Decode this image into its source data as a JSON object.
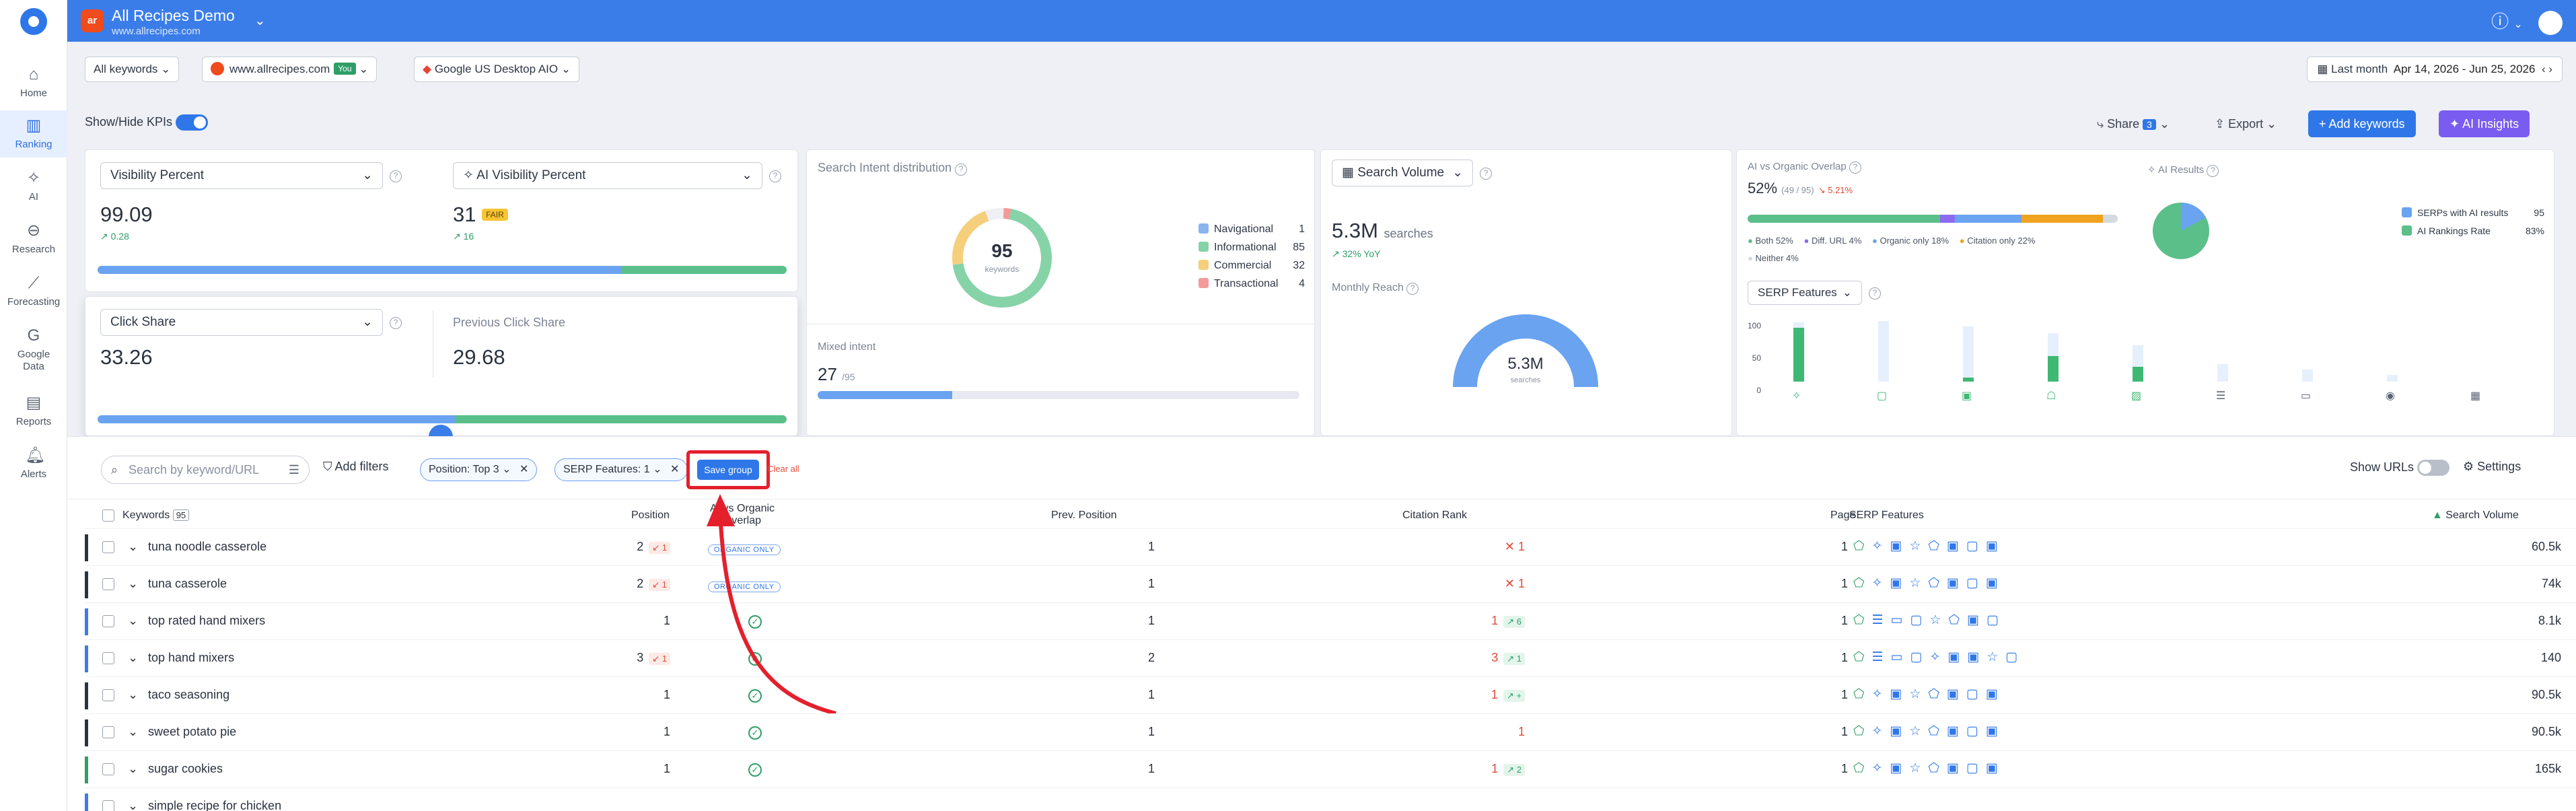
{
  "sidebar": {
    "items": [
      {
        "label": "Home",
        "icon": "home-icon"
      },
      {
        "label": "Ranking",
        "icon": "ranking-icon"
      },
      {
        "label": "AI",
        "icon": "ai-icon"
      },
      {
        "label": "Research",
        "icon": "research-icon"
      },
      {
        "label": "Forecasting",
        "icon": "forecasting-icon"
      },
      {
        "label": "Google Data",
        "icon": "google-data-icon"
      },
      {
        "label": "Reports",
        "icon": "reports-icon"
      },
      {
        "label": "Alerts",
        "icon": "alerts-icon"
      }
    ]
  },
  "project": {
    "name": "All Recipes Demo",
    "url": "www.allrecipes.com",
    "logo": "ar"
  },
  "filters": {
    "keywords": "All keywords",
    "domain": "www.allrecipes.com",
    "you": "You",
    "engine": "Google US Desktop AIO",
    "period_label": "Last month",
    "period": "Apr 14, 2026 - Jun 25, 2026"
  },
  "actions": {
    "kpis": "Show/Hide KPIs",
    "share": "Share",
    "share_count": "3",
    "export": "Export",
    "add": "Add keywords",
    "ai": "AI Insights"
  },
  "kpi": {
    "vis_label": "Visibility Percent",
    "vis_value": "99.09",
    "vis_delta": "0.28",
    "aivis_label": "AI Visibility Percent",
    "aivis_value": "31",
    "aivis_badge": "FAIR",
    "aivis_delta": "16",
    "click_label": "Click Share",
    "click_value": "33.26",
    "prev_label": "Previous Click Share",
    "prev_value": "29.68"
  },
  "intent": {
    "title": "Search Intent distribution",
    "total": "95",
    "total_label": "keywords",
    "items": [
      {
        "label": "Navigational",
        "value": "1",
        "color": "#8ab4f0"
      },
      {
        "label": "Informational",
        "value": "85",
        "color": "#86d3a7"
      },
      {
        "label": "Commercial",
        "value": "32",
        "color": "#f6cf7c"
      },
      {
        "label": "Transactional",
        "value": "4",
        "color": "#f39a9a"
      }
    ],
    "mixed_label": "Mixed intent",
    "mixed_value": "27",
    "mixed_total": "/95",
    "mixed_fraction": 0.28
  },
  "volume": {
    "label": "Search Volume",
    "value": "5.3M",
    "unit": "searches",
    "yoy": "32% YoY",
    "reach_label": "Monthly Reach",
    "gauge_value": "5.3M",
    "gauge_unit": "searches"
  },
  "overlap": {
    "title": "AI vs Organic Overlap",
    "pct": "52%",
    "frac": "(49 / 95)",
    "delta": "5.21%",
    "legend": [
      {
        "label": "Both 52%",
        "color": "#5bbf8a"
      },
      {
        "label": "Diff. URL 4%",
        "color": "#8b6cf0"
      },
      {
        "label": "Organic only 18%",
        "color": "#6aa3f0"
      },
      {
        "label": "Citation only 22%",
        "color": "#f0a31e"
      },
      {
        "label": "Neither 4%",
        "color": "#d5d9e0"
      }
    ]
  },
  "airesults": {
    "title": "AI Results",
    "items": [
      {
        "label": "SERPs with AI results",
        "value": "95"
      },
      {
        "label": "AI Rankings Rate",
        "value": "83%"
      }
    ]
  },
  "serpfeat": {
    "label": "SERP Features",
    "yticks": [
      "100",
      "50",
      "0"
    ]
  },
  "table": {
    "search_placeholder": "Search by keyword/URL",
    "add_filters": "Add filters",
    "chip1": "Position: Top 3",
    "chip2": "SERP Features: 1",
    "save": "Save group",
    "clear": "Clear all",
    "show_urls": "Show URLs",
    "settings": "Settings",
    "headers": {
      "keywords": "Keywords",
      "count": "95",
      "position": "Position",
      "overlap": "AI vs Organic Overlap",
      "prev": "Prev. Position",
      "citation": "Citation Rank",
      "page": "Page",
      "serp": "SERP Features",
      "volume": "Search Volume"
    },
    "rows": [
      {
        "kw": "tuna noodle casserole",
        "pos": "2",
        "pd": "1",
        "ov": "ORGANIC ONLY",
        "prev": "1",
        "cite": "✕ 1",
        "page": "1",
        "vol": "60.5k"
      },
      {
        "kw": "tuna casserole",
        "pos": "2",
        "pd": "1",
        "ov": "ORGANIC ONLY",
        "prev": "1",
        "cite": "✕ 1",
        "page": "1",
        "vol": "74k"
      },
      {
        "kw": "top rated hand mixers",
        "pos": "1",
        "pd": "",
        "ov": "",
        "prev": "1",
        "cite": "1",
        "cu": "6",
        "page": "1",
        "vol": "8.1k"
      },
      {
        "kw": "top hand mixers",
        "pos": "3",
        "pd": "1",
        "ov": "",
        "prev": "2",
        "cite": "3",
        "cu": "1",
        "page": "1",
        "vol": "140"
      },
      {
        "kw": "taco seasoning",
        "pos": "1",
        "pd": "",
        "ov": "",
        "prev": "1",
        "cite": "1",
        "cu": "+",
        "page": "1",
        "vol": "90.5k"
      },
      {
        "kw": "sweet potato pie",
        "pos": "1",
        "pd": "",
        "ov": "",
        "prev": "1",
        "cite": "1",
        "page": "1",
        "vol": "90.5k"
      },
      {
        "kw": "sugar cookies",
        "pos": "1",
        "pd": "",
        "ov": "",
        "prev": "1",
        "cite": "1",
        "cu": "2",
        "page": "1",
        "vol": "165k"
      },
      {
        "kw": "simple recipe for chicken",
        "pos": "",
        "pd": "",
        "ov": "",
        "prev": "",
        "cite": "",
        "page": "",
        "vol": ""
      }
    ]
  }
}
